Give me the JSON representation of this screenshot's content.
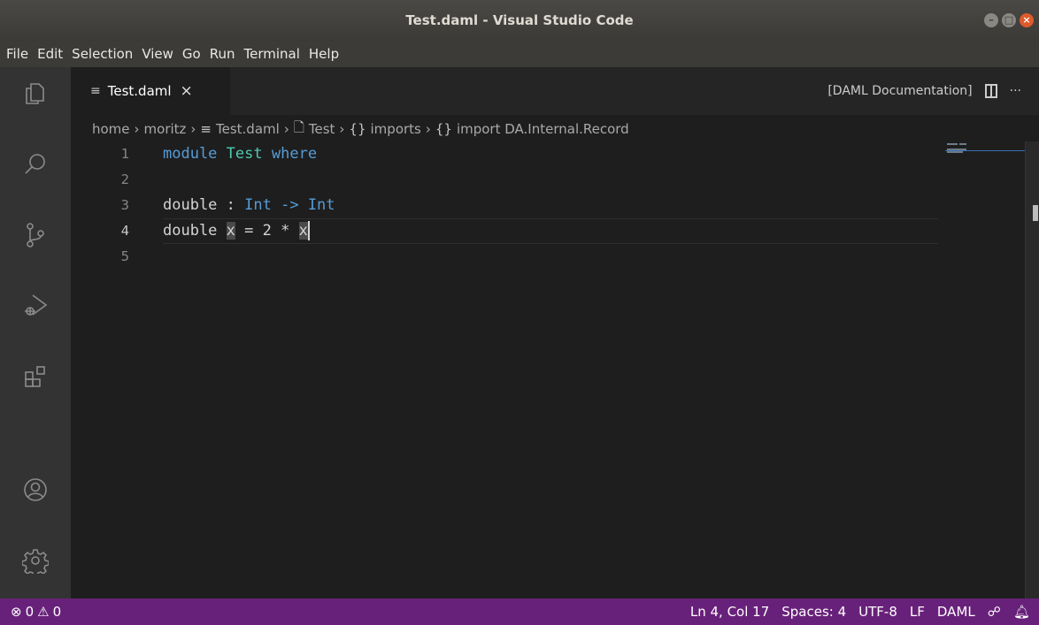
{
  "window": {
    "title": "Test.daml - Visual Studio Code"
  },
  "menu": [
    "File",
    "Edit",
    "Selection",
    "View",
    "Go",
    "Run",
    "Terminal",
    "Help"
  ],
  "tab": {
    "label": "Test.daml",
    "close": "×"
  },
  "tab_actions": {
    "doc_label": "[DAML Documentation]",
    "more": "···"
  },
  "breadcrumbs": {
    "home": "home",
    "user": "moritz",
    "file": "Test.daml",
    "module": "Test",
    "imports": "imports",
    "import": "import DA.Internal.Record",
    "braces": "{}"
  },
  "editor": {
    "line_numbers": [
      "1",
      "2",
      "3",
      "4",
      "5"
    ],
    "lines": [
      {
        "kw1": "module",
        "type": "Test",
        "kw2": "where"
      },
      {},
      {
        "name": "double",
        "colon": " : ",
        "t1": "Int",
        "arrow": " -> ",
        "t2": "Int"
      },
      {
        "name": "double",
        "sp": " ",
        "var1": "x",
        "rest": " = 2 * ",
        "var2": "x"
      },
      {}
    ]
  },
  "status": {
    "errors": "0",
    "warnings": "0",
    "position": "Ln 4, Col 17",
    "spaces": "Spaces: 4",
    "encoding": "UTF-8",
    "eol": "LF",
    "language": "DAML"
  },
  "colors": {
    "statusbar": "#68217a",
    "keyword": "#569cd6",
    "type": "#4ec9b0"
  }
}
